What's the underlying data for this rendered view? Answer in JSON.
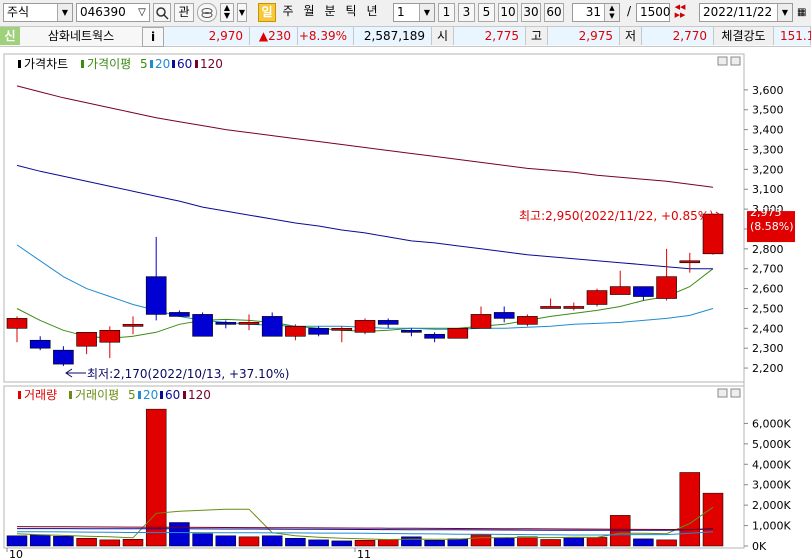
{
  "toolbar": {
    "market_type": "주식",
    "code": "046390",
    "code_arrow": "▽",
    "search_icon": "search-icon",
    "fav_label": "관",
    "period_buttons": [
      "일",
      "주",
      "월",
      "분",
      "틱",
      "년"
    ],
    "period_active": "일",
    "interval_value": "1",
    "interval_buttons": [
      "1",
      "3",
      "5",
      "10",
      "30",
      "60"
    ],
    "display_count": "31",
    "total_count": "1500",
    "slash": "/",
    "date_value": "2022/11/22"
  },
  "infobar": {
    "credit_badge": "신",
    "stock_name": "삼화네트웍스",
    "info_button": "i",
    "price": "2,970",
    "change": "▲230",
    "change_pct": "+8.39%",
    "volume": "2,587,189",
    "open_label": "시",
    "open_value": "2,775",
    "high_label": "고",
    "high_value": "2,975",
    "low_label": "저",
    "low_value": "2,770",
    "strength_label": "체결강도",
    "strength_value": "151.1"
  },
  "chart_data": [
    {
      "type": "candlestick",
      "legend": {
        "price_label": "가격차트",
        "ma_label": "가격이평",
        "ma_periods": [
          "5",
          "20",
          "60",
          "120"
        ]
      },
      "ylim": [
        2150,
        3700
      ],
      "yticks": [
        "3,600",
        "3,500",
        "3,400",
        "3,300",
        "3,200",
        "3,100",
        "3,000",
        "2,900",
        "2,800",
        "2,700",
        "2,600",
        "2,500",
        "2,400",
        "2,300",
        "2,200"
      ],
      "ytick_values": [
        3600,
        3500,
        3400,
        3300,
        3200,
        3100,
        3000,
        2900,
        2800,
        2700,
        2600,
        2500,
        2400,
        2300,
        2200
      ],
      "xlabels": [
        {
          "index": 0,
          "label": "10"
        },
        {
          "index": 15,
          "label": "11"
        }
      ],
      "current_price_label": "2,975",
      "current_pct_label": "(8.58%)",
      "current_price": 2975,
      "annotations": {
        "high": "최고:2,950(2022/11/22, +0.85%)",
        "low": "최저:2,170(2022/10/13, +37.10%)"
      },
      "candles": [
        {
          "o": 2400,
          "h": 2460,
          "l": 2330,
          "c": 2450
        },
        {
          "o": 2340,
          "h": 2360,
          "l": 2290,
          "c": 2300
        },
        {
          "o": 2290,
          "h": 2310,
          "l": 2210,
          "c": 2220
        },
        {
          "o": 2310,
          "h": 2380,
          "l": 2270,
          "c": 2380
        },
        {
          "o": 2330,
          "h": 2410,
          "l": 2250,
          "c": 2390
        },
        {
          "o": 2410,
          "h": 2460,
          "l": 2370,
          "c": 2420
        },
        {
          "o": 2660,
          "h": 2860,
          "l": 2440,
          "c": 2470
        },
        {
          "o": 2480,
          "h": 2490,
          "l": 2460,
          "c": 2460
        },
        {
          "o": 2470,
          "h": 2480,
          "l": 2360,
          "c": 2360
        },
        {
          "o": 2430,
          "h": 2440,
          "l": 2400,
          "c": 2420
        },
        {
          "o": 2420,
          "h": 2470,
          "l": 2390,
          "c": 2430
        },
        {
          "o": 2460,
          "h": 2480,
          "l": 2360,
          "c": 2360
        },
        {
          "o": 2360,
          "h": 2420,
          "l": 2340,
          "c": 2410
        },
        {
          "o": 2400,
          "h": 2410,
          "l": 2360,
          "c": 2370
        },
        {
          "o": 2390,
          "h": 2410,
          "l": 2330,
          "c": 2400
        },
        {
          "o": 2380,
          "h": 2450,
          "l": 2370,
          "c": 2440
        },
        {
          "o": 2440,
          "h": 2450,
          "l": 2400,
          "c": 2420
        },
        {
          "o": 2390,
          "h": 2400,
          "l": 2360,
          "c": 2380
        },
        {
          "o": 2370,
          "h": 2380,
          "l": 2330,
          "c": 2350
        },
        {
          "o": 2350,
          "h": 2400,
          "l": 2350,
          "c": 2400
        },
        {
          "o": 2400,
          "h": 2510,
          "l": 2400,
          "c": 2470
        },
        {
          "o": 2480,
          "h": 2510,
          "l": 2430,
          "c": 2450
        },
        {
          "o": 2420,
          "h": 2470,
          "l": 2410,
          "c": 2460
        },
        {
          "o": 2510,
          "h": 2550,
          "l": 2500,
          "c": 2510
        },
        {
          "o": 2510,
          "h": 2530,
          "l": 2490,
          "c": 2510
        },
        {
          "o": 2520,
          "h": 2600,
          "l": 2510,
          "c": 2590
        },
        {
          "o": 2570,
          "h": 2690,
          "l": 2570,
          "c": 2610
        },
        {
          "o": 2610,
          "h": 2610,
          "l": 2540,
          "c": 2560
        },
        {
          "o": 2550,
          "h": 2800,
          "l": 2540,
          "c": 2660
        },
        {
          "o": 2730,
          "h": 2780,
          "l": 2680,
          "c": 2740
        },
        {
          "o": 2775,
          "h": 2975,
          "l": 2770,
          "c": 2975
        }
      ],
      "ma": [
        {
          "period": "5",
          "color": "#3c8c14",
          "values": [
            2500,
            2440,
            2390,
            2360,
            2350,
            2360,
            2380,
            2420,
            2440,
            2445,
            2440,
            2430,
            2410,
            2400,
            2390,
            2385,
            2390,
            2400,
            2400,
            2400,
            2410,
            2420,
            2440,
            2460,
            2475,
            2490,
            2510,
            2540,
            2560,
            2610,
            2700
          ]
        },
        {
          "period": "20",
          "color": "#1e8cd2",
          "values": [
            2820,
            2740,
            2660,
            2600,
            2560,
            2520,
            2490,
            2460,
            2440,
            2430,
            2420,
            2415,
            2410,
            2410,
            2410,
            2405,
            2400,
            2400,
            2395,
            2395,
            2400,
            2400,
            2405,
            2410,
            2420,
            2425,
            2430,
            2440,
            2450,
            2465,
            2500
          ]
        },
        {
          "period": "60",
          "color": "#0a0a96",
          "values": [
            3220,
            3190,
            3165,
            3140,
            3115,
            3090,
            3065,
            3040,
            3010,
            2990,
            2970,
            2950,
            2930,
            2915,
            2895,
            2880,
            2860,
            2840,
            2830,
            2815,
            2800,
            2785,
            2770,
            2760,
            2750,
            2740,
            2730,
            2720,
            2710,
            2700,
            2700
          ]
        },
        {
          "period": "120",
          "color": "#780028",
          "values": [
            3620,
            3590,
            3560,
            3535,
            3510,
            3485,
            3460,
            3440,
            3420,
            3400,
            3385,
            3370,
            3355,
            3340,
            3325,
            3310,
            3295,
            3280,
            3265,
            3250,
            3235,
            3220,
            3205,
            3195,
            3185,
            3170,
            3160,
            3150,
            3140,
            3125,
            3110
          ]
        }
      ]
    },
    {
      "type": "bar",
      "legend": {
        "volume_label": "거래량",
        "ma_label": "거래이평",
        "ma_periods": [
          "5",
          "20",
          "60",
          "120"
        ]
      },
      "ylim": [
        0,
        7000000
      ],
      "yticks": [
        "6,000K",
        "5,000K",
        "4,000K",
        "3,000K",
        "2,000K",
        "1,000K",
        "0K"
      ],
      "ytick_values": [
        6000000,
        5000000,
        4000000,
        3000000,
        2000000,
        1000000,
        0
      ],
      "volumes": [
        500000,
        550000,
        480000,
        380000,
        300000,
        330000,
        6700000,
        1150000,
        600000,
        500000,
        450000,
        500000,
        380000,
        300000,
        250000,
        280000,
        320000,
        450000,
        280000,
        350000,
        550000,
        400000,
        450000,
        320000,
        400000,
        420000,
        1500000,
        350000,
        300000,
        3600000,
        2587189
      ],
      "prev_up": [
        false,
        false,
        false,
        true,
        true,
        true,
        true,
        false,
        false,
        false,
        true,
        false,
        false,
        false,
        false,
        true,
        true,
        false,
        false,
        false,
        true,
        false,
        true,
        true,
        false,
        true,
        true,
        false,
        true,
        true,
        true
      ],
      "ma": [
        {
          "period": "5",
          "color": "#6a8c14",
          "values": [
            600000,
            550000,
            520000,
            480000,
            450000,
            400000,
            1600000,
            1700000,
            1750000,
            1800000,
            1800000,
            650000,
            500000,
            430000,
            380000,
            350000,
            320000,
            340000,
            330000,
            340000,
            400000,
            410000,
            420000,
            410000,
            430000,
            420000,
            630000,
            620000,
            600000,
            1100000,
            1900000
          ]
        },
        {
          "period": "20",
          "color": "#1e8cd2",
          "values": [
            700000,
            700000,
            690000,
            680000,
            670000,
            660000,
            660000,
            660000,
            650000,
            650000,
            650000,
            640000,
            640000,
            630000,
            630000,
            620000,
            610000,
            600000,
            590000,
            580000,
            580000,
            570000,
            560000,
            550000,
            540000,
            540000,
            550000,
            560000,
            560000,
            620000,
            700000
          ]
        },
        {
          "period": "60",
          "color": "#0a0a96",
          "values": [
            850000,
            850000,
            850000,
            845000,
            840000,
            840000,
            840000,
            840000,
            835000,
            830000,
            830000,
            825000,
            820000,
            820000,
            815000,
            810000,
            805000,
            800000,
            800000,
            795000,
            790000,
            785000,
            780000,
            775000,
            770000,
            770000,
            770000,
            770000,
            770000,
            800000,
            850000
          ]
        },
        {
          "period": "120",
          "color": "#780028",
          "values": [
            950000,
            945000,
            940000,
            935000,
            930000,
            925000,
            920000,
            915000,
            910000,
            905000,
            900000,
            895000,
            890000,
            885000,
            880000,
            875000,
            870000,
            865000,
            860000,
            855000,
            850000,
            845000,
            840000,
            835000,
            830000,
            825000,
            820000,
            815000,
            810000,
            810000,
            820000
          ]
        }
      ]
    }
  ]
}
